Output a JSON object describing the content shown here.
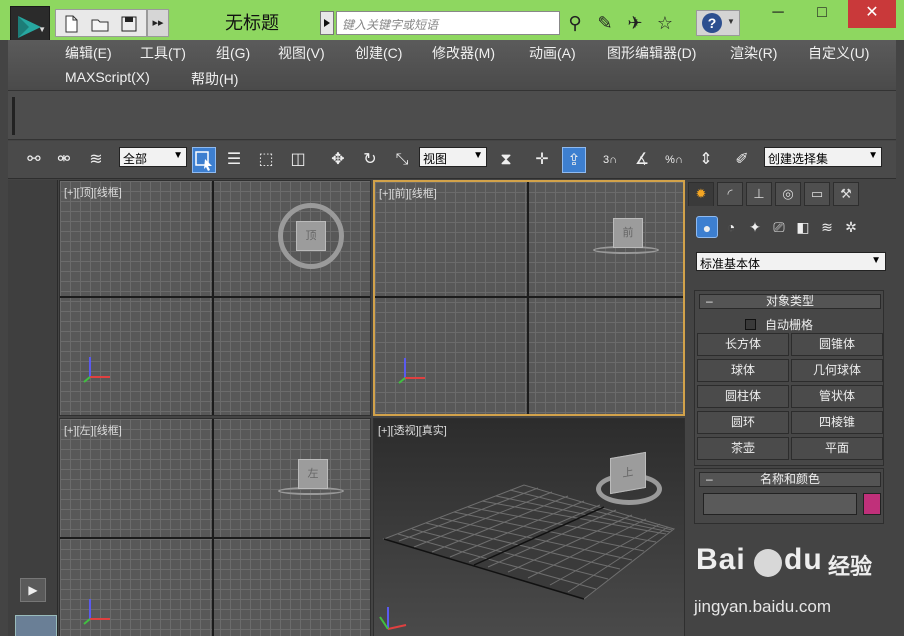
{
  "titlebar": {
    "title": "无标题",
    "search_placeholder": "键入关键字或短语",
    "minimize": "─",
    "maximize": "□",
    "close": "✕"
  },
  "menu": [
    "编辑(E)",
    "工具(T)",
    "组(G)",
    "视图(V)",
    "创建(C)",
    "修改器(M)",
    "动画(A)",
    "图形编辑器(D)",
    "渲染(R)",
    "自定义(U)",
    "MAXScript(X)",
    "帮助(H)"
  ],
  "toolbar": {
    "selection_filter": "全部",
    "reference_coord": "视图",
    "snap_labels": [
      "3",
      "%"
    ],
    "named_selection": "创建选择集"
  },
  "viewports": {
    "top": {
      "label": "[+][顶][线框]",
      "cube_face": "顶"
    },
    "front": {
      "label": "[+][前][线框]",
      "cube_face": "前"
    },
    "left": {
      "label": "[+][左][线框]",
      "cube_face": "左"
    },
    "perspective": {
      "label": "[+][透视][真实]",
      "cube_face": "上"
    }
  },
  "command_panel": {
    "category": "标准基本体",
    "object_type_title": "对象类型",
    "autogrid_label": "自动栅格",
    "objects": [
      "长方体",
      "圆锥体",
      "球体",
      "几何球体",
      "圆柱体",
      "管状体",
      "圆环",
      "四棱锥",
      "茶壶",
      "平面"
    ],
    "name_color_title": "名称和颜色",
    "color_swatch": "#c0307a"
  },
  "watermark": {
    "brand_1": "Bai",
    "brand_2": "经验",
    "url": "jingyan.baidu.com"
  },
  "colors": {
    "window_frame": "#8ed760",
    "accent_blue": "#3d7fd0",
    "active_viewport": "#d2a24a",
    "close_red": "#c9393a"
  }
}
